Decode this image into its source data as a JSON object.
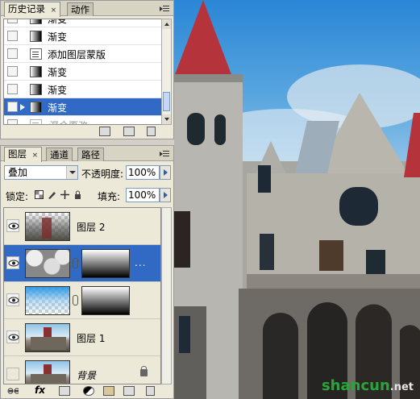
{
  "history": {
    "tabs": [
      {
        "label": "历史记录",
        "close": "×"
      },
      {
        "label": "动作"
      }
    ],
    "items": [
      {
        "label": "渐变",
        "icon": "gradient-icon"
      },
      {
        "label": "渐变",
        "icon": "gradient-icon"
      },
      {
        "label": "添加图层蒙版",
        "icon": "document-icon"
      },
      {
        "label": "渐变",
        "icon": "gradient-icon"
      },
      {
        "label": "渐变",
        "icon": "gradient-icon"
      },
      {
        "label": "渐变",
        "icon": "gradient-icon"
      },
      {
        "label": "混合更改",
        "icon": "document-icon"
      }
    ],
    "selected_index": 5,
    "footer_icons": [
      "new-snapshot-icon",
      "create-document-icon",
      "trash-icon"
    ]
  },
  "layers": {
    "tabs": [
      {
        "label": "图层",
        "close": "×"
      },
      {
        "label": "通道"
      },
      {
        "label": "路径"
      }
    ],
    "blend_mode": "叠加",
    "opacity_label": "不透明度:",
    "opacity_value": "100%",
    "lock_label": "锁定:",
    "fill_label": "填充:",
    "fill_value": "100%",
    "rows": [
      {
        "name": "图层 2",
        "visible": true
      },
      {
        "name": "",
        "visible": true,
        "selected": true,
        "dots": "..."
      },
      {
        "name": "",
        "visible": true,
        "dots": ""
      },
      {
        "name": "图层 1",
        "visible": true
      },
      {
        "name": "背景",
        "visible": false,
        "locked": true
      }
    ],
    "footer_icons": [
      "link-icon",
      "fx-icon",
      "add-mask-icon",
      "adjustment-icon",
      "group-icon",
      "new-layer-icon",
      "trash-icon"
    ]
  },
  "watermark": {
    "text": "shancun",
    "suffix": ".net",
    "color": "#2aa53b"
  },
  "colors": {
    "selection": "#316ac5",
    "panel": "#ece9d8"
  }
}
